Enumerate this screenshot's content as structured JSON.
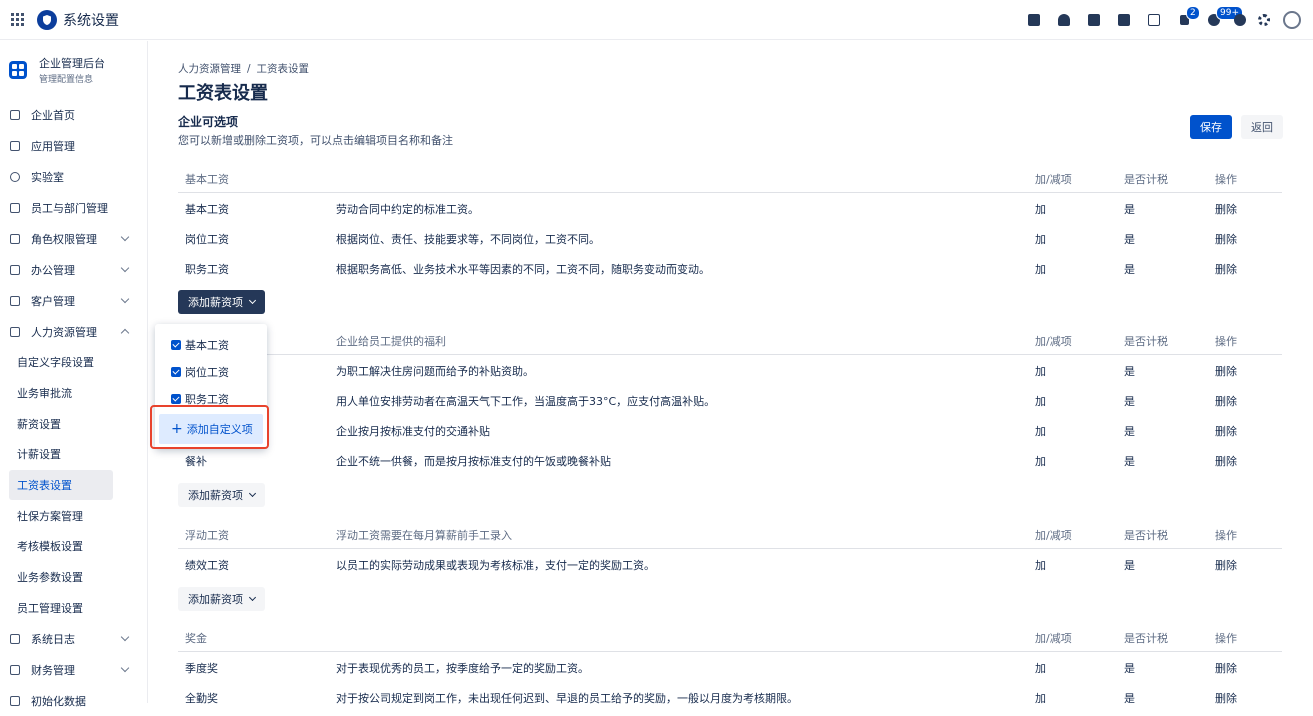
{
  "app": {
    "title": "系统设置"
  },
  "topbar": {
    "badge_flag": "2",
    "badge_bell": "99+"
  },
  "sidebar": {
    "header_title": "企业管理后台",
    "header_sub": "管理配置信息",
    "items": [
      {
        "label": "企业首页"
      },
      {
        "label": "应用管理"
      },
      {
        "label": "实验室"
      },
      {
        "label": "员工与部门管理"
      },
      {
        "label": "角色权限管理"
      },
      {
        "label": "办公管理"
      },
      {
        "label": "客户管理"
      },
      {
        "label": "人力资源管理"
      }
    ],
    "subitems": [
      {
        "label": "自定义字段设置"
      },
      {
        "label": "业务审批流"
      },
      {
        "label": "薪资设置"
      },
      {
        "label": "计薪设置"
      },
      {
        "label": "工资表设置"
      },
      {
        "label": "社保方案管理"
      },
      {
        "label": "考核模板设置"
      },
      {
        "label": "业务参数设置"
      },
      {
        "label": "员工管理设置"
      }
    ],
    "bottom_items": [
      {
        "label": "系统日志"
      },
      {
        "label": "财务管理"
      },
      {
        "label": "初始化数据"
      }
    ]
  },
  "main": {
    "breadcrumb": [
      "人力资源管理",
      "工资表设置"
    ],
    "breadcrumb_sep": "/",
    "title": "工资表设置",
    "section_title": "企业可选项",
    "section_desc": "您可以新增或删除工资项，可以点击编辑项目名称和备注",
    "save_label": "保存",
    "back_label": "返回",
    "add_item_label": "添加薪资项",
    "col_add_sub": "加/减项",
    "col_taxable": "是否计税",
    "col_action": "操作",
    "groups": [
      {
        "name": "基本工资",
        "desc": "",
        "rows": [
          {
            "name": "基本工资",
            "desc": "劳动合同中约定的标准工资。",
            "addsub": "加",
            "taxable": "是",
            "action": "删除"
          },
          {
            "name": "岗位工资",
            "desc": "根据岗位、责任、技能要求等，不同岗位，工资不同。",
            "addsub": "加",
            "taxable": "是",
            "action": "删除"
          },
          {
            "name": "职务工资",
            "desc": "根据职务高低、业务技术水平等因素的不同，工资不同，随职务变动而变动。",
            "addsub": "加",
            "taxable": "是",
            "action": "删除"
          }
        ]
      },
      {
        "name": "",
        "desc": "企业给员工提供的福利",
        "rows": [
          {
            "name": "",
            "desc": "为职工解决住房问题而给予的补贴资助。",
            "addsub": "加",
            "taxable": "是",
            "action": "删除"
          },
          {
            "name": "",
            "desc": "用人单位安排劳动者在高温天气下工作，当温度高于33°C，应支付高温补贴。",
            "addsub": "加",
            "taxable": "是",
            "action": "删除"
          },
          {
            "name": "",
            "desc": "企业按月按标准支付的交通补贴",
            "addsub": "加",
            "taxable": "是",
            "action": "删除"
          },
          {
            "name": "餐补",
            "desc": "企业不统一供餐，而是按月按标准支付的午饭或晚餐补贴",
            "addsub": "加",
            "taxable": "是",
            "action": "删除"
          }
        ]
      },
      {
        "name": "浮动工资",
        "desc": "浮动工资需要在每月算薪前手工录入",
        "rows": [
          {
            "name": "绩效工资",
            "desc": "以员工的实际劳动成果或表现为考核标准，支付一定的奖励工资。",
            "addsub": "加",
            "taxable": "是",
            "action": "删除"
          }
        ]
      },
      {
        "name": "奖金",
        "desc": "",
        "rows": [
          {
            "name": "季度奖",
            "desc": "对于表现优秀的员工，按季度给予一定的奖励工资。",
            "addsub": "加",
            "taxable": "是",
            "action": "删除"
          },
          {
            "name": "全勤奖",
            "desc": "对于按公司规定到岗工作，未出现任何迟到、早退的员工给予的奖励，一般以月度为考核期限。",
            "addsub": "加",
            "taxable": "是",
            "action": "删除"
          }
        ]
      }
    ]
  },
  "dropdown": {
    "options": [
      {
        "label": "基本工资",
        "checked": true
      },
      {
        "label": "岗位工资",
        "checked": true
      },
      {
        "label": "职务工资",
        "checked": true
      }
    ],
    "add_custom_label": "添加自定义项"
  },
  "colors": {
    "primary": "#0052cc",
    "dark_button": "#253858",
    "highlight": "#e8432d"
  }
}
